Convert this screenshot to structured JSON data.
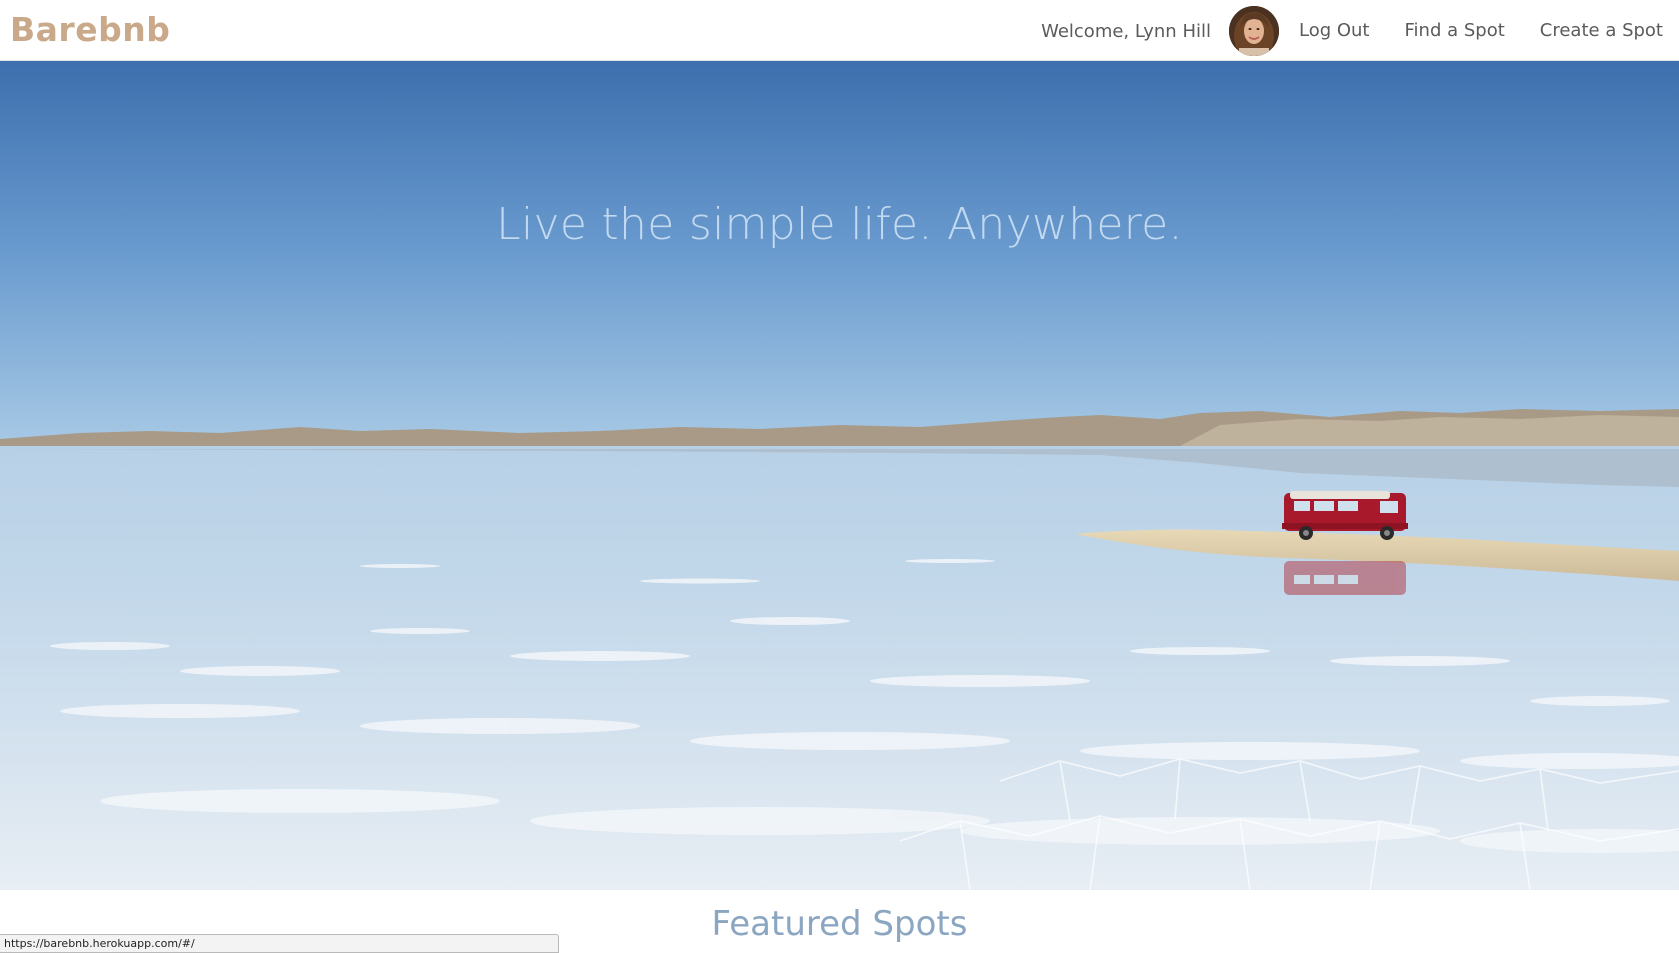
{
  "navbar": {
    "brand": "Barebnb",
    "welcome": "Welcome, Lynn Hill",
    "links": {
      "log_out": "Log Out",
      "find_spot": "Find a Spot",
      "create_spot": "Create a Spot"
    },
    "avatar_icon": "user-avatar"
  },
  "hero": {
    "tagline": "Live the simple life. Anywhere."
  },
  "featured": {
    "title": "Featured Spots"
  },
  "status_bar": {
    "url": "https://barebnb.herokuapp.com/#/"
  },
  "colors": {
    "brand": "#c9a989",
    "nav_text": "#5b5b5b",
    "featured_title": "#8aa6c1",
    "sky_top": "#3f72b1",
    "sky_horizon": "#9dc2e2"
  }
}
